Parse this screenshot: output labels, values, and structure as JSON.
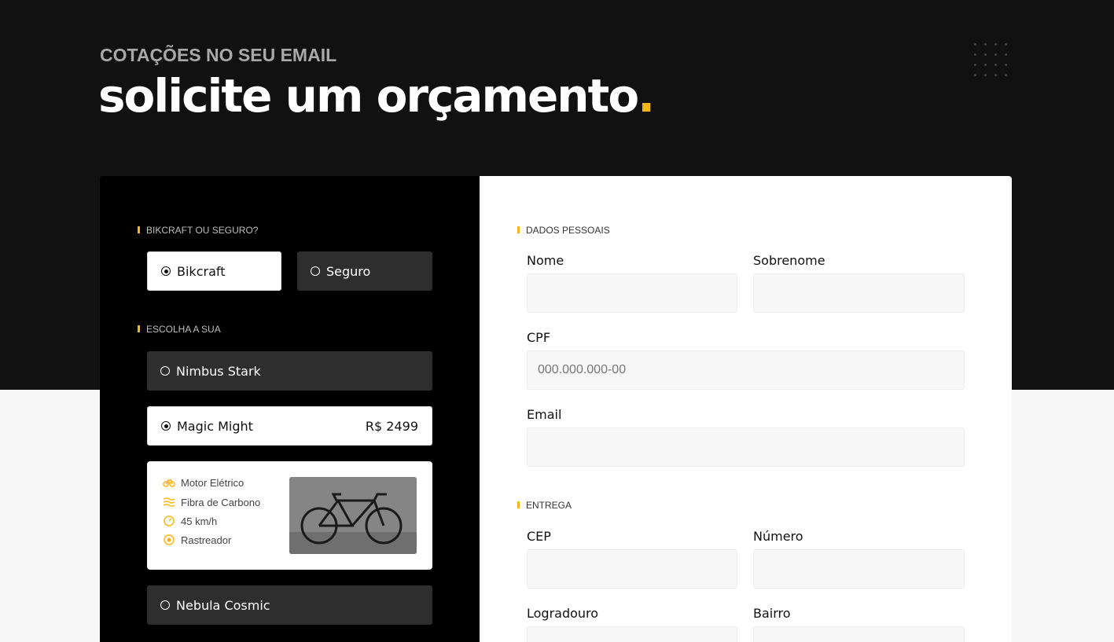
{
  "hero": {
    "subtitle": "COTAÇÕES NO SEU EMAIL",
    "title": "solicite um orçamento",
    "title_dot": "."
  },
  "left_panel": {
    "type_section": {
      "label": "BIKCRAFT OU SEGURO?",
      "options": [
        {
          "label": "Bikcraft",
          "selected": true
        },
        {
          "label": "Seguro",
          "selected": false
        }
      ]
    },
    "choose_section": {
      "label": "ESCOLHA A SUA",
      "bikes": [
        {
          "name": "Nimbus Stark",
          "selected": false
        },
        {
          "name": "Magic Might",
          "selected": true,
          "price": "R$ 2499"
        },
        {
          "name": "Nebula Cosmic",
          "selected": false
        }
      ]
    },
    "details": {
      "features": [
        {
          "icon": "electric-bike-icon",
          "label": "Motor Elétrico"
        },
        {
          "icon": "carbon-fiber-icon",
          "label": "Fibra de Carbono"
        },
        {
          "icon": "speedometer-icon",
          "label": "45 km/h"
        },
        {
          "icon": "tracker-icon",
          "label": "Rastreador"
        }
      ]
    }
  },
  "right_panel": {
    "personal_section": {
      "label": "DADOS PESSOAIS",
      "nome": {
        "label": "Nome",
        "value": ""
      },
      "sobrenome": {
        "label": "Sobrenome",
        "value": ""
      },
      "cpf": {
        "label": "CPF",
        "placeholder": "000.000.000-00"
      },
      "email": {
        "label": "Email",
        "value": ""
      }
    },
    "delivery_section": {
      "label": "ENTREGA",
      "cep": {
        "label": "CEP"
      },
      "numero": {
        "label": "Número"
      },
      "logradouro": {
        "label": "Logradouro"
      },
      "bairro": {
        "label": "Bairro"
      }
    }
  },
  "colors": {
    "accent": "#fbb614",
    "hero_bg": "#111111",
    "panel_dark": "#000000",
    "option_dark": "#2e2e2e"
  }
}
